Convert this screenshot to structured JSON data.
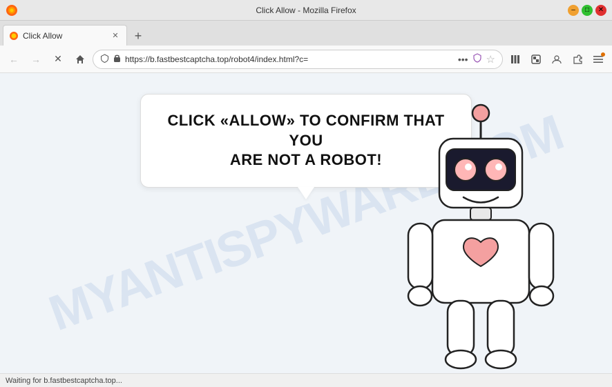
{
  "window": {
    "title": "Click Allow - Mozilla Firefox",
    "tab_label": "Click Allow",
    "url": "https://b.fastbestcaptcha.top/robot4/index.html?c=",
    "url_display": "https://b.fastbestcaptcha.top/robot4/index.html?c=",
    "status": "Waiting for b.fastbestcaptcha.top..."
  },
  "nav": {
    "back_label": "←",
    "forward_label": "→",
    "stop_label": "✕",
    "home_label": "⌂",
    "more_label": "•••",
    "bookmark_label": "☆",
    "new_tab_label": "+"
  },
  "content": {
    "bubble_line1": "CLICK «ALLOW» TO CONFIRM THAT YOU",
    "bubble_line2": "ARE NOT A ROBOT!",
    "watermark_line1": "MYANTISPYWARE.COM"
  },
  "icons": {
    "back": "←",
    "forward": "→",
    "stop": "✕",
    "home": "🏠",
    "lock": "🔒",
    "shield": "🛡",
    "bookmark": "☆",
    "library": "📚",
    "sync": "⇌",
    "download": "↓",
    "menu": "≡"
  }
}
